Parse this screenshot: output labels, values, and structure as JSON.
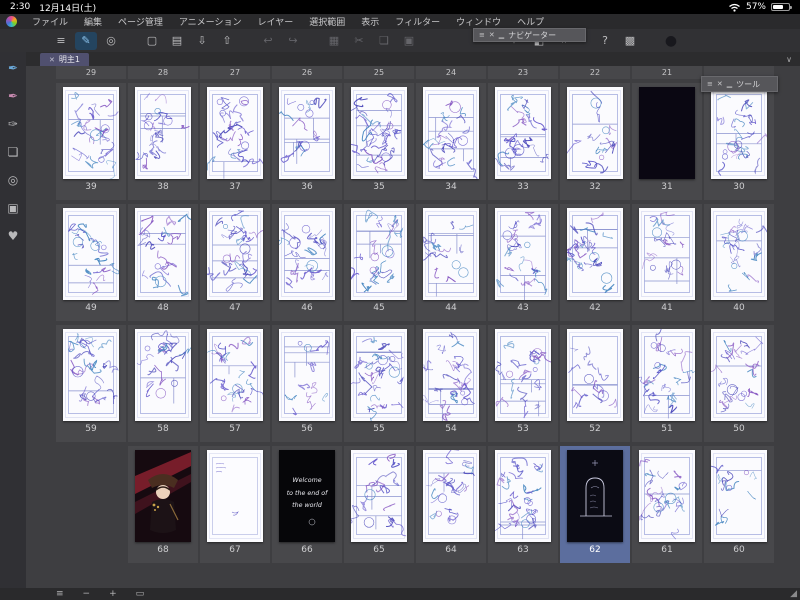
{
  "status_bar": {
    "time": "2:30",
    "date": "12月14日(土)",
    "battery_percent": "57%"
  },
  "menu_bar": {
    "items": [
      "ファイル",
      "編集",
      "ページ管理",
      "アニメーション",
      "レイヤー",
      "選択範囲",
      "表示",
      "フィルター",
      "ウィンドウ",
      "ヘルプ"
    ]
  },
  "toolbar": {
    "items": [
      {
        "name": "main-menu",
        "glyph": "≡"
      },
      {
        "name": "pen-tool",
        "glyph": "✎",
        "state": "active"
      },
      {
        "name": "object-tool",
        "glyph": "◎"
      },
      {
        "separator": true
      },
      {
        "name": "new-page",
        "glyph": "▢"
      },
      {
        "name": "open-folder",
        "glyph": "▤"
      },
      {
        "name": "import",
        "glyph": "⇩"
      },
      {
        "name": "export",
        "glyph": "⇧"
      },
      {
        "separator": true
      },
      {
        "name": "undo",
        "glyph": "↩",
        "state": "disabled"
      },
      {
        "name": "redo",
        "glyph": "↪",
        "state": "disabled"
      },
      {
        "separator": true
      },
      {
        "name": "rect-select",
        "glyph": "▦",
        "state": "disabled"
      },
      {
        "name": "cut",
        "glyph": "✂",
        "state": "disabled"
      },
      {
        "name": "copy",
        "glyph": "❏",
        "state": "disabled"
      },
      {
        "name": "paste",
        "glyph": "▣",
        "state": "disabled"
      },
      {
        "separator": true
      },
      {
        "separator": true
      },
      {
        "separator": true
      },
      {
        "separator": true
      },
      {
        "separator": true
      },
      {
        "name": "wand",
        "glyph": "✦"
      },
      {
        "name": "gradient",
        "glyph": "◧"
      },
      {
        "name": "frame-border",
        "glyph": "⌗"
      },
      {
        "separator": true
      },
      {
        "name": "help",
        "glyph": "?"
      },
      {
        "name": "grid-view",
        "glyph": "▩"
      },
      {
        "separator": true
      },
      {
        "name": "main-color",
        "glyph": "●"
      }
    ]
  },
  "tab": {
    "title": "明主1",
    "close_glyph": "✕",
    "chevron_glyph": "∨"
  },
  "sidebar": {
    "items": [
      {
        "name": "collapse-sidebar",
        "glyph": "«",
        "small": true
      },
      {
        "name": "pen-stand-blue",
        "glyph": "✒",
        "tint": "#6aa8d8"
      },
      {
        "name": "pen-stand-pink",
        "glyph": "✒",
        "tint": "#c88ab0"
      },
      {
        "name": "pen-stand-gray",
        "glyph": "✑",
        "tint": "#b9b9bb"
      },
      {
        "name": "layers-panel",
        "glyph": "❏"
      },
      {
        "name": "zoom-panel",
        "glyph": "◎"
      },
      {
        "name": "materials-panel",
        "glyph": "▣"
      },
      {
        "name": "favorites-panel",
        "glyph": "♥"
      }
    ]
  },
  "palettes": {
    "navigator": {
      "title": "ナビゲーター",
      "controls": [
        "≡",
        "✕",
        "▁"
      ]
    },
    "tool": {
      "title": "ツール",
      "controls": [
        "≡",
        "✕",
        "▁"
      ]
    }
  },
  "page_grid": {
    "header_numbers": [
      "29",
      "28",
      "27",
      "26",
      "25",
      "24",
      "23",
      "22",
      "21"
    ],
    "rows": [
      {
        "pages": [
          {
            "num": "39",
            "type": "sketch"
          },
          {
            "num": "38",
            "type": "sketch"
          },
          {
            "num": "37",
            "type": "sketch"
          },
          {
            "num": "36",
            "type": "sketch"
          },
          {
            "num": "35",
            "type": "sketch"
          },
          {
            "num": "34",
            "type": "sketch"
          },
          {
            "num": "33",
            "type": "sketch"
          },
          {
            "num": "32",
            "type": "sketch"
          },
          {
            "num": "31",
            "type": "black"
          },
          {
            "num": "30",
            "type": "sketch"
          }
        ]
      },
      {
        "pages": [
          {
            "num": "49",
            "type": "sketch"
          },
          {
            "num": "48",
            "type": "sketch"
          },
          {
            "num": "47",
            "type": "sketch"
          },
          {
            "num": "46",
            "type": "sketch"
          },
          {
            "num": "45",
            "type": "sketch"
          },
          {
            "num": "44",
            "type": "sketch"
          },
          {
            "num": "43",
            "type": "sketch"
          },
          {
            "num": "42",
            "type": "sketch"
          },
          {
            "num": "41",
            "type": "sketch"
          },
          {
            "num": "40",
            "type": "sketch"
          }
        ]
      },
      {
        "pages": [
          {
            "num": "59",
            "type": "sketch"
          },
          {
            "num": "58",
            "type": "sketch"
          },
          {
            "num": "57",
            "type": "sketch"
          },
          {
            "num": "56",
            "type": "sketch"
          },
          {
            "num": "55",
            "type": "sketch"
          },
          {
            "num": "54",
            "type": "sketch"
          },
          {
            "num": "53",
            "type": "sketch"
          },
          {
            "num": "52",
            "type": "sketch"
          },
          {
            "num": "51",
            "type": "sketch"
          },
          {
            "num": "50",
            "type": "sketch"
          }
        ]
      },
      {
        "offset": 1,
        "pages": [
          {
            "num": "68",
            "type": "cover"
          },
          {
            "num": "67",
            "type": "light"
          },
          {
            "num": "66",
            "type": "text",
            "lines": [
              "Welcome",
              "to the end of",
              "the world"
            ]
          },
          {
            "num": "65",
            "type": "sketch"
          },
          {
            "num": "64",
            "type": "sketch"
          },
          {
            "num": "63",
            "type": "sketch"
          },
          {
            "num": "62",
            "type": "dark",
            "selected": true
          },
          {
            "num": "61",
            "type": "sketch"
          },
          {
            "num": "60",
            "type": "sketch"
          }
        ]
      }
    ]
  },
  "bottom_bar": {
    "items": [
      {
        "name": "thumbnail-menu",
        "glyph": "≡"
      },
      {
        "name": "zoom-out",
        "glyph": "−"
      },
      {
        "name": "zoom-in",
        "glyph": "+"
      },
      {
        "name": "fit-view",
        "glyph": "▭"
      }
    ],
    "grip_glyph": "◢"
  },
  "colors": {
    "selection": "#5c6e9e",
    "sketch_line": "#5450c6",
    "active_tool": "#8cc4ee"
  }
}
